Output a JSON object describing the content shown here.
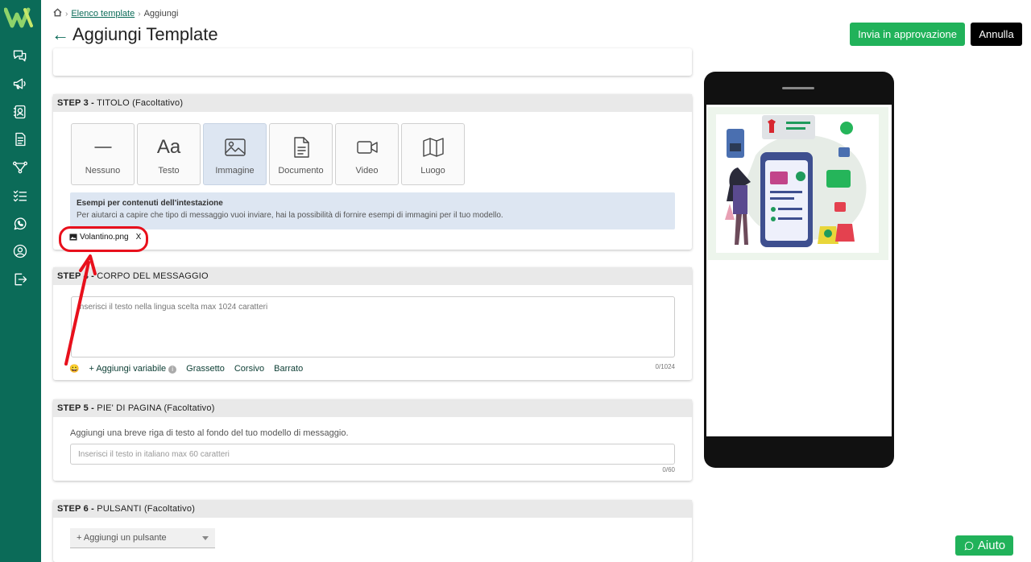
{
  "header": {
    "breadcrumb": {
      "link": "Elenco template",
      "current": "Aggiungi"
    },
    "title": "Aggiungi Template",
    "approve_label": "Invia in approvazione",
    "cancel_label": "Annulla"
  },
  "step3": {
    "step": "STEP 3 -",
    "title": "TITOLO (Facoltativo)",
    "types": [
      {
        "label": "Nessuno",
        "icon": "dash-icon"
      },
      {
        "label": "Testo",
        "icon": "text-aa-icon"
      },
      {
        "label": "Immagine",
        "icon": "image-icon",
        "active": true
      },
      {
        "label": "Documento",
        "icon": "document-icon"
      },
      {
        "label": "Video",
        "icon": "video-icon"
      },
      {
        "label": "Luogo",
        "icon": "map-icon"
      }
    ],
    "text_glyph": "Aa",
    "info_title": "Esempi per contenuti dell'intestazione",
    "info_desc": "Per aiutarci a capire che tipo di messaggio vuoi inviare, hai la possibilità di fornire esempi di immagini per il tuo modello.",
    "file_name": "Volantino.png",
    "file_remove": "X"
  },
  "step4": {
    "step": "STEP 4 -",
    "title": "CORPO DEL MESSAGGIO",
    "placeholder": "Inserisci il testo nella lingua scelta max 1024 caratteri",
    "emoji": "😀",
    "add_variable": "+ Aggiungi variabile",
    "bold": "Grassetto",
    "italic": "Corsivo",
    "strike": "Barrato",
    "counter": "0/1024"
  },
  "step5": {
    "step": "STEP 5 -",
    "title": "PIE' DI PAGINA (Facoltativo)",
    "desc": "Aggiungi una breve riga di testo al fondo del tuo modello di messaggio.",
    "placeholder": "Inserisci il testo in italiano max 60 caratteri",
    "counter": "0/60"
  },
  "step6": {
    "step": "STEP 6 -",
    "title": "PULSANTI (Facoltativo)",
    "select_label": "+ Aggiungi un pulsante"
  },
  "help": {
    "label": "Aiuto"
  },
  "colors": {
    "brand": "#0b6b58",
    "accent": "#21b25a",
    "annotation": "#e8101c"
  }
}
